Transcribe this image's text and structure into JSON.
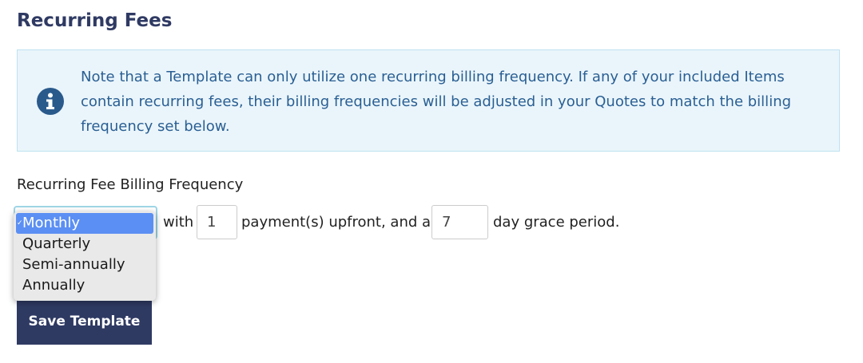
{
  "section": {
    "title": "Recurring Fees"
  },
  "notice": {
    "icon": "info-circle-icon",
    "text": "Note that a Template can only utilize one recurring billing frequency. If any of your included Items contain recurring fees, their billing frequencies will be adjusted in your Quotes to match the billing frequency set below."
  },
  "frequency": {
    "label": "Recurring Fee Billing Frequency",
    "selected": "Monthly",
    "options": [
      "Monthly",
      "Quarterly",
      "Semi-annually",
      "Annually"
    ],
    "check_glyph": "✓",
    "with_text": "with",
    "payments_upfront_value": "1",
    "payments_text": "payment(s) upfront, and a",
    "grace_period_value": "7",
    "grace_text": "day grace period."
  },
  "actions": {
    "save_label": "Save Template"
  },
  "colors": {
    "title": "#2f3a63",
    "notice_bg": "#eaf5fb",
    "notice_text": "#2a5f93",
    "selected_option_bg": "#5b8ff3",
    "button_bg": "#2f3a63"
  }
}
